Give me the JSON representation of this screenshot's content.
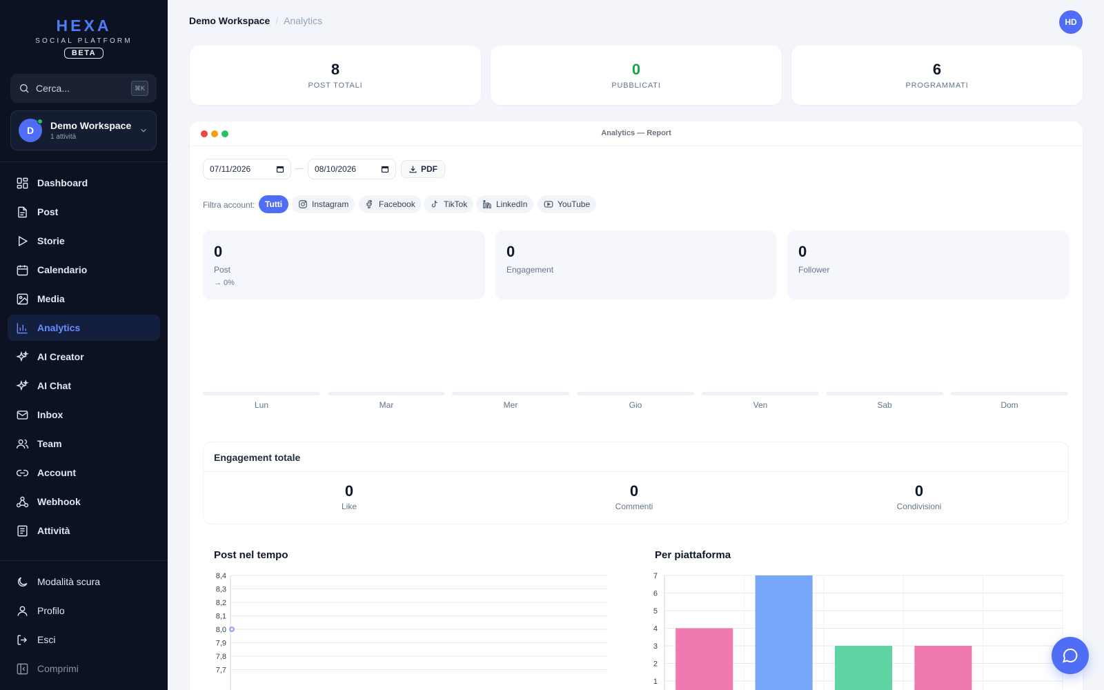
{
  "brand": {
    "name": "HEXA",
    "subtitle": "SOCIAL PLATFORM",
    "badge": "BETA"
  },
  "search": {
    "placeholder": "Cerca...",
    "shortcut": "⌘K"
  },
  "workspace": {
    "initial": "D",
    "name": "Demo Workspace",
    "meta": "1 attività"
  },
  "nav": [
    {
      "label": "Dashboard",
      "icon": "dashboard-icon"
    },
    {
      "label": "Post",
      "icon": "document-icon"
    },
    {
      "label": "Storie",
      "icon": "play-icon"
    },
    {
      "label": "Calendario",
      "icon": "calendar-icon"
    },
    {
      "label": "Media",
      "icon": "image-icon"
    },
    {
      "label": "Analytics",
      "icon": "chart-icon",
      "active": true
    },
    {
      "label": "AI Creator",
      "icon": "sparkles-icon"
    },
    {
      "label": "AI Chat",
      "icon": "sparkles-icon"
    },
    {
      "label": "Inbox",
      "icon": "mail-icon"
    },
    {
      "label": "Team",
      "icon": "users-icon"
    },
    {
      "label": "Account",
      "icon": "link-icon"
    },
    {
      "label": "Webhook",
      "icon": "webhook-icon"
    },
    {
      "label": "Attività",
      "icon": "activity-icon"
    }
  ],
  "bottom_nav": [
    {
      "label": "Modalità scura",
      "icon": "moon-icon"
    },
    {
      "label": "Profilo",
      "icon": "user-icon"
    },
    {
      "label": "Esci",
      "icon": "logout-icon"
    },
    {
      "label": "Comprimi",
      "icon": "collapse-icon"
    }
  ],
  "breadcrumb": {
    "workspace": "Demo Workspace",
    "separator": "/",
    "page": "Analytics"
  },
  "user": {
    "initials": "HD"
  },
  "stats": [
    {
      "value": "8",
      "label": "POST TOTALI",
      "color": "#0f172a"
    },
    {
      "value": "0",
      "label": "PUBBLICATI",
      "color": "#16a34a"
    },
    {
      "value": "6",
      "label": "PROGRAMMATI",
      "color": "#0f172a"
    }
  ],
  "report": {
    "title": "Analytics — Report",
    "date_from": "07/11/2026",
    "date_sep": "—",
    "date_to": "08/10/2026",
    "pdf_label": "PDF",
    "filter_label": "Filtra account:",
    "filters": [
      {
        "label": "Tutti",
        "active": true
      },
      {
        "label": "Instagram",
        "icon": "instagram-icon"
      },
      {
        "label": "Facebook",
        "icon": "facebook-icon"
      },
      {
        "label": "TikTok",
        "icon": "tiktok-icon"
      },
      {
        "label": "LinkedIn",
        "icon": "linkedin-icon"
      },
      {
        "label": "YouTube",
        "icon": "youtube-icon"
      }
    ],
    "kpis": [
      {
        "value": "0",
        "label": "Post",
        "trend": "→ 0%"
      },
      {
        "value": "0",
        "label": "Engagement"
      },
      {
        "value": "0",
        "label": "Follower"
      }
    ],
    "week_days": [
      "Lun",
      "Mar",
      "Mer",
      "Gio",
      "Ven",
      "Sab",
      "Dom"
    ],
    "engagement": {
      "title": "Engagement totale",
      "items": [
        {
          "value": "0",
          "label": "Like"
        },
        {
          "value": "0",
          "label": "Commenti"
        },
        {
          "value": "0",
          "label": "Condivisioni"
        }
      ]
    }
  },
  "chart_data": [
    {
      "type": "line",
      "title": "Post nel tempo",
      "ylim": [
        7.7,
        8.4
      ],
      "yticks": [
        "8,4",
        "8,3",
        "8,2",
        "8,1",
        "8,0",
        "7,9",
        "7,8",
        "7,7"
      ],
      "series": [
        {
          "values": [
            8.0
          ]
        }
      ],
      "grid": true
    },
    {
      "type": "bar",
      "title": "Per piattaforma",
      "ylim": [
        1,
        7
      ],
      "yticks": [
        "7",
        "6",
        "5",
        "4",
        "3",
        "2",
        "1"
      ],
      "values": [
        4,
        7,
        3,
        3,
        0
      ],
      "colors": [
        "#f07ab0",
        "#76a6f7",
        "#5fd3a2",
        "#f07ab0",
        "#ffffff"
      ],
      "grid": true
    }
  ],
  "colors": {
    "accent": "#4f6ef5",
    "sidebar": "#0c1222",
    "success": "#16a34a"
  }
}
